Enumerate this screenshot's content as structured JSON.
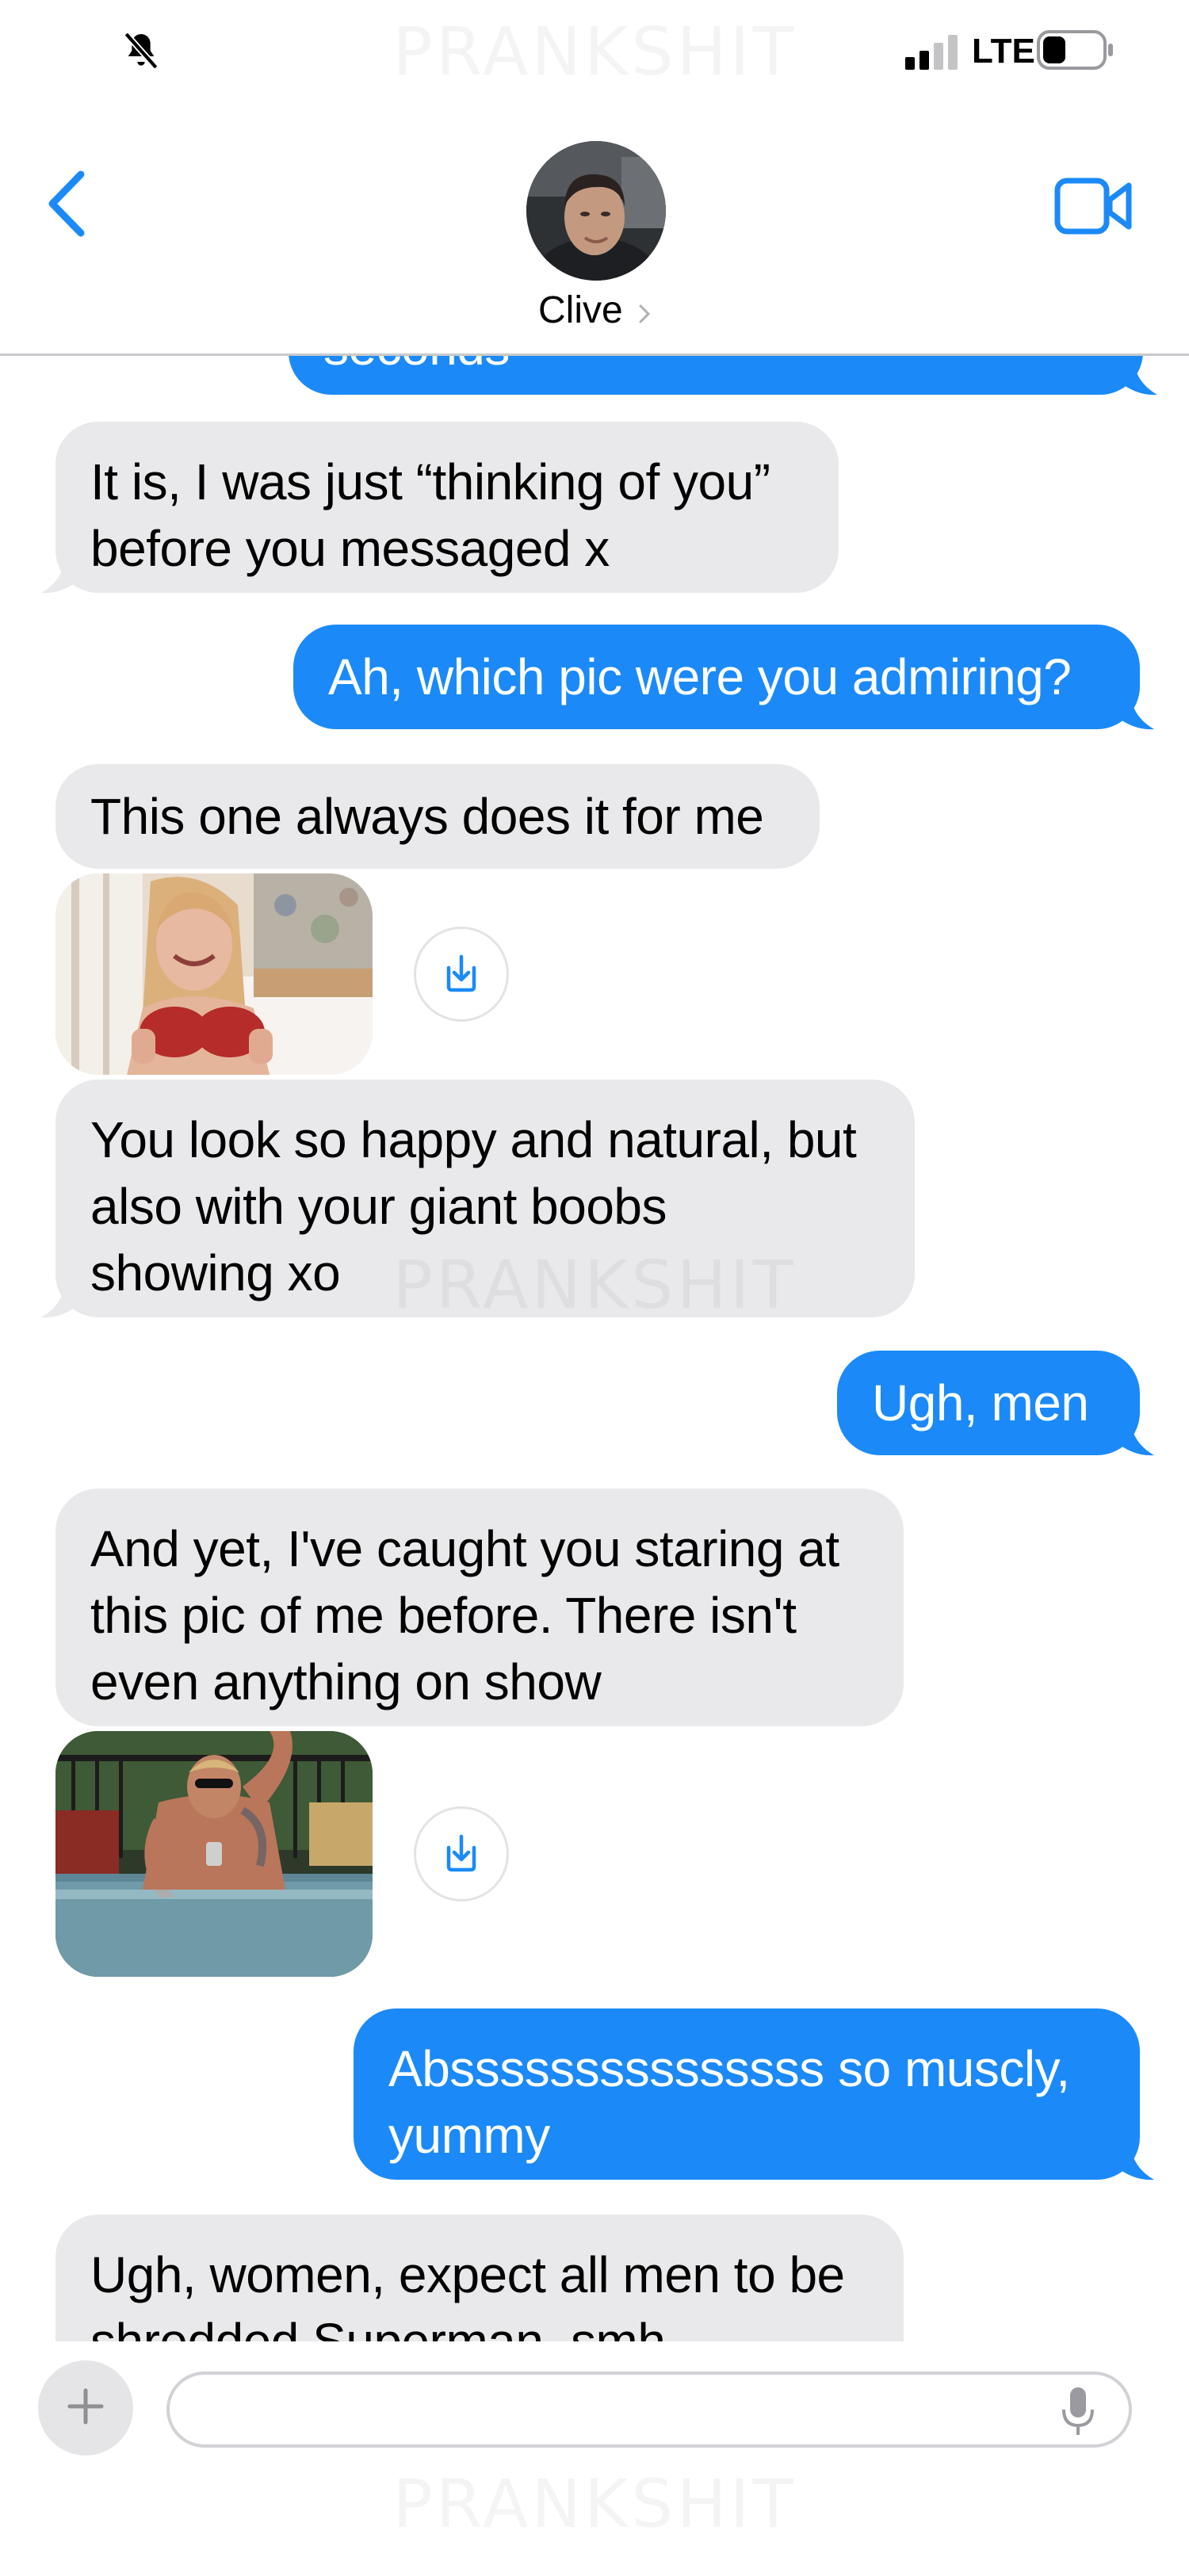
{
  "status_bar": {
    "network": "LTE",
    "icons": [
      "bell-slash-icon",
      "signal-icon",
      "battery-icon"
    ]
  },
  "watermark": "PRANKSHIT",
  "header": {
    "contact_name": "Clive",
    "icons": [
      "back-chevron-icon",
      "avatar",
      "video-call-icon",
      "chevron-right-icon"
    ]
  },
  "messages": [
    {
      "direction": "sent",
      "text": "seconds"
    },
    {
      "direction": "received",
      "lines": [
        "It is, I was just “thinking of you”",
        "before you messaged x"
      ]
    },
    {
      "direction": "sent",
      "text": "Ah, which pic were you admiring?"
    },
    {
      "direction": "received",
      "text": "This one always does it for me"
    },
    {
      "direction": "received",
      "type": "image",
      "subject": "woman-photo"
    },
    {
      "direction": "received",
      "lines": [
        "You look so happy and natural, but",
        "also with your giant boobs",
        "showing xo"
      ]
    },
    {
      "direction": "sent",
      "text": "Ugh, men"
    },
    {
      "direction": "received",
      "lines": [
        "And yet, I've caught you staring at",
        "this pic of me before. There isn't",
        "even anything on show"
      ]
    },
    {
      "direction": "received",
      "type": "image",
      "subject": "man-pool-photo"
    },
    {
      "direction": "sent",
      "lines": [
        "Absssssssssssssss so muscly,",
        "yummy"
      ]
    },
    {
      "direction": "received",
      "lines": [
        "Ugh, women, expect all men to be",
        "shredded Superman, smh"
      ]
    }
  ],
  "colors": {
    "accent": "#1b8af8",
    "received_bubble": "#e9e9eb",
    "header_divider": "#c9c9cd"
  },
  "composer": {
    "input_value": "",
    "icons": [
      "plus-icon",
      "microphone-icon"
    ]
  }
}
